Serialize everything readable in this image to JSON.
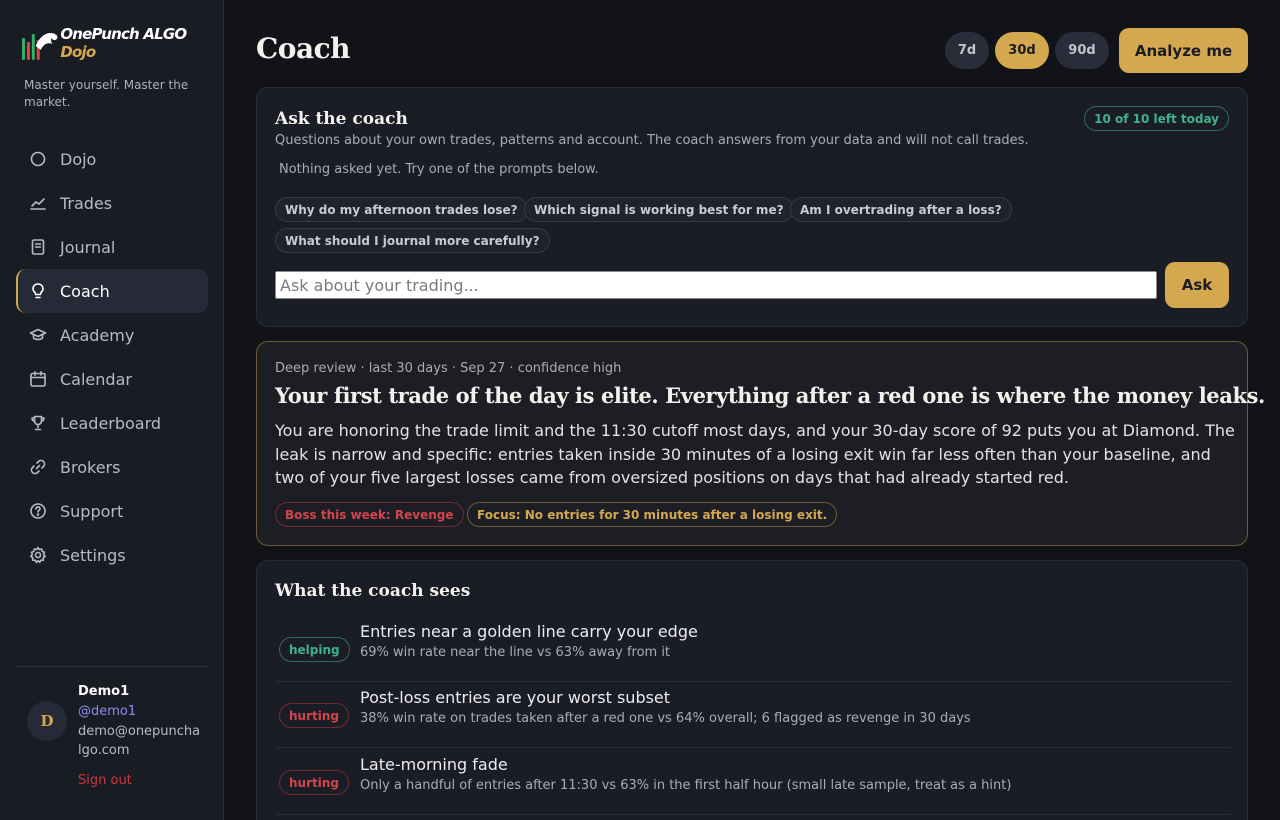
{
  "brand": {
    "name_part1": "OnePunch ALGO",
    "name_part2": "Dojo",
    "tagline": "Master yourself. Master the market."
  },
  "sidebar": {
    "items": [
      {
        "label": "Dojo",
        "icon": "circle-icon"
      },
      {
        "label": "Trades",
        "icon": "line-chart-icon"
      },
      {
        "label": "Journal",
        "icon": "journal-icon"
      },
      {
        "label": "Coach",
        "icon": "lightbulb-icon",
        "active": true
      },
      {
        "label": "Academy",
        "icon": "graduation-cap-icon"
      },
      {
        "label": "Calendar",
        "icon": "calendar-icon"
      },
      {
        "label": "Leaderboard",
        "icon": "trophy-icon"
      },
      {
        "label": "Brokers",
        "icon": "link-icon"
      },
      {
        "label": "Support",
        "icon": "help-circle-icon"
      },
      {
        "label": "Settings",
        "icon": "gear-icon"
      }
    ]
  },
  "user": {
    "initial": "D",
    "name": "Demo1",
    "handle": "@demo1",
    "email": "demo@onepunchalgo.com",
    "sign_out": "Sign out"
  },
  "header": {
    "title": "Coach",
    "ranges": [
      "7d",
      "30d",
      "90d"
    ],
    "selected_range": "30d",
    "analyze_label": "Analyze me"
  },
  "ask": {
    "title": "Ask the coach",
    "subtitle": "Questions about your own trades, patterns and account. The coach answers from your data and will not call trades.",
    "quota": "10 of 10 left today",
    "empty_state": "Nothing asked yet. Try one of the prompts below.",
    "prompts": [
      "Why do my afternoon trades lose?",
      "Which signal is working best for me?",
      "Am I overtrading after a loss?",
      "What should I journal more carefully?"
    ],
    "placeholder": "Ask about your trading...",
    "button": "Ask"
  },
  "review": {
    "meta": "Deep review · last 30 days · Sep 27 · confidence high",
    "headline": "Your first trade of the day is elite. Everything after a red one is where the money leaks.",
    "body": "You are honoring the trade limit and the 11:30 cutoff most days, and your 30-day score of 92 puts you at Diamond. The leak is narrow and specific: entries taken inside 30 minutes of a losing exit win far less often than your baseline, and two of your five largest losses came from oversized positions on days that had already started red.",
    "boss": "Boss this week: Revenge",
    "focus": "Focus: No entries for 30 minutes after a losing exit."
  },
  "sees": {
    "title": "What the coach sees",
    "items": [
      {
        "status": "helping",
        "title": "Entries near a golden line carry your edge",
        "detail": "69% win rate near the line vs 63% away from it"
      },
      {
        "status": "hurting",
        "title": "Post-loss entries are your worst subset",
        "detail": "38% win rate on trades taken after a red one vs 64% overall; 6 flagged as revenge in 30 days"
      },
      {
        "status": "hurting",
        "title": "Late-morning fade",
        "detail": "Only a handful of entries after 11:30 vs 63% in the first half hour (small late sample, treat as a hint)"
      }
    ]
  },
  "colors": {
    "accent": "#d4a84f",
    "background": "#121319",
    "sidebar": "#1a1c24",
    "helping": "#3fb28a",
    "hurting": "#d2444b"
  }
}
